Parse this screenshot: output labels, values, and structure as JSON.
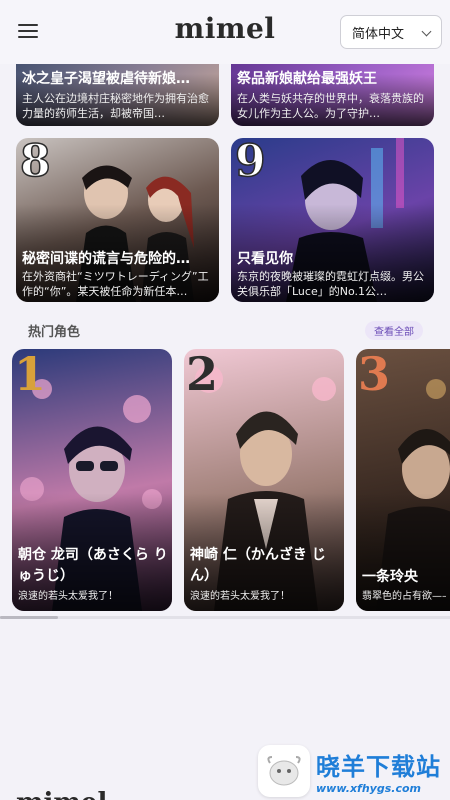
{
  "header": {
    "menu_icon": "hamburger-menu-icon",
    "logo": "mimel",
    "language": "简体中文"
  },
  "story_cards": [
    {
      "rank": "",
      "title": "冰之皇子渴望被虐待新娘…",
      "desc": "主人公在边境村庄秘密地作为拥有治愈力量的药师生活，却被帝国…",
      "colors": [
        "#3a4a6a",
        "#8a7f95",
        "#c9a99a"
      ]
    },
    {
      "rank": "",
      "title": "祭品新娘献给最强妖王",
      "desc": "在人类与妖共存的世界中，衰落贵族的女儿作为主人公。为了守护…",
      "colors": [
        "#5a2f8a",
        "#9a5fc5",
        "#d07fe0"
      ]
    },
    {
      "rank": "8",
      "title": "秘密间谍的谎言与危险的…",
      "desc": "在外资商社“ミツワトレーディング”工作的“你”。某天被任命为新任本…",
      "colors": [
        "#c9c3c0",
        "#6d5a52",
        "#241a18"
      ]
    },
    {
      "rank": "9",
      "title": "只看见你",
      "desc": "东京的夜晚被璀璨的霓虹灯点缀。男公关俱乐部「Luce」的No.1公…",
      "colors": [
        "#2a3c8a",
        "#6a43a8",
        "#1a1a3a"
      ]
    }
  ],
  "section": {
    "title": "热门角色",
    "view_all": "查看全部"
  },
  "hot_characters": [
    {
      "rank": "1",
      "rank_color": "#d8a13a",
      "name": "朝仓 龙司（あさくら りゅうじ）",
      "tag": "浪速的若头太爱我了！",
      "colors": [
        "#2b3a7a",
        "#c07aa8",
        "#3a2240"
      ]
    },
    {
      "rank": "2",
      "rank_color": "#2d2d2d",
      "name": "神崎 仁（かんざき じん）",
      "tag": "浪速的若头太爱我了！",
      "colors": [
        "#f0c8d4",
        "#a08078",
        "#3a2c28"
      ]
    },
    {
      "rank": "3",
      "rank_color": "#e07a50",
      "name": "一条玲央",
      "tag": "翡翠色的占有欲——",
      "colors": [
        "#6a5040",
        "#3a2a22",
        "#1a1410"
      ]
    }
  ],
  "watermark": {
    "title": "晓羊下载站",
    "url": "www.xfhygs.com",
    "icon": "sheep-logo-icon"
  },
  "footer_logo": "mimel"
}
